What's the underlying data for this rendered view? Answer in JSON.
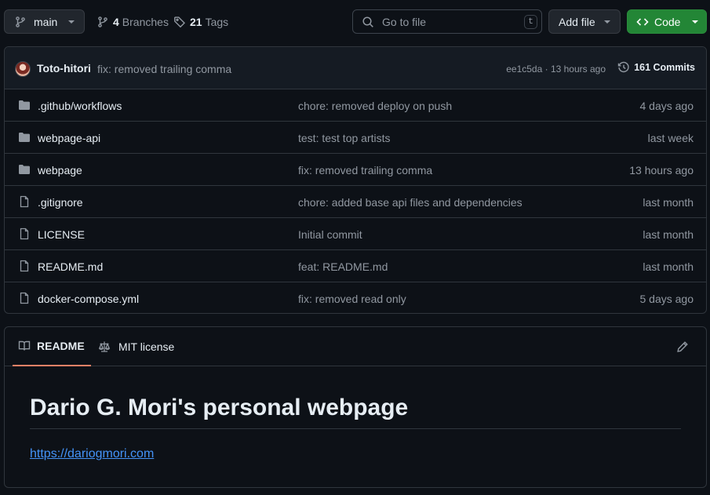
{
  "toolbar": {
    "branch": "main",
    "branches_count": "4",
    "branches_label": "Branches",
    "tags_count": "21",
    "tags_label": "Tags",
    "search_placeholder": "Go to file",
    "search_shortcut": "t",
    "add_file_label": "Add file",
    "code_label": "Code"
  },
  "latest_commit": {
    "author": "Toto-hitori",
    "message": "fix: removed trailing comma",
    "hash_time": "ee1c5da · 13 hours ago",
    "commits_label": "161 Commits"
  },
  "files": [
    {
      "type": "folder",
      "name": ".github/workflows",
      "message": "chore: removed deploy on push",
      "date": "4 days ago"
    },
    {
      "type": "folder",
      "name": "webpage-api",
      "message": "test: test top artists",
      "date": "last week"
    },
    {
      "type": "folder",
      "name": "webpage",
      "message": "fix: removed trailing comma",
      "date": "13 hours ago"
    },
    {
      "type": "file",
      "name": ".gitignore",
      "message": "chore: added base api files and dependencies",
      "date": "last month"
    },
    {
      "type": "file",
      "name": "LICENSE",
      "message": "Initial commit",
      "date": "last month"
    },
    {
      "type": "file",
      "name": "README.md",
      "message": "feat: README.md",
      "date": "last month"
    },
    {
      "type": "file",
      "name": "docker-compose.yml",
      "message": "fix: removed read only",
      "date": "5 days ago"
    }
  ],
  "readme": {
    "tab_readme": "README",
    "tab_license": "MIT license",
    "title": "Dario G. Mori's personal webpage",
    "link": "https://dariogmori.com"
  },
  "colors": {
    "background": "#0d1117",
    "code_button": "#238636",
    "link": "#4493f8",
    "tab_underline": "#f78166"
  },
  "icons": [
    "branch-icon",
    "git-branch-icon",
    "tag-icon",
    "search-icon",
    "code-icon",
    "history-icon",
    "folder-icon",
    "file-icon",
    "book-icon",
    "law-icon",
    "pencil-icon"
  ]
}
